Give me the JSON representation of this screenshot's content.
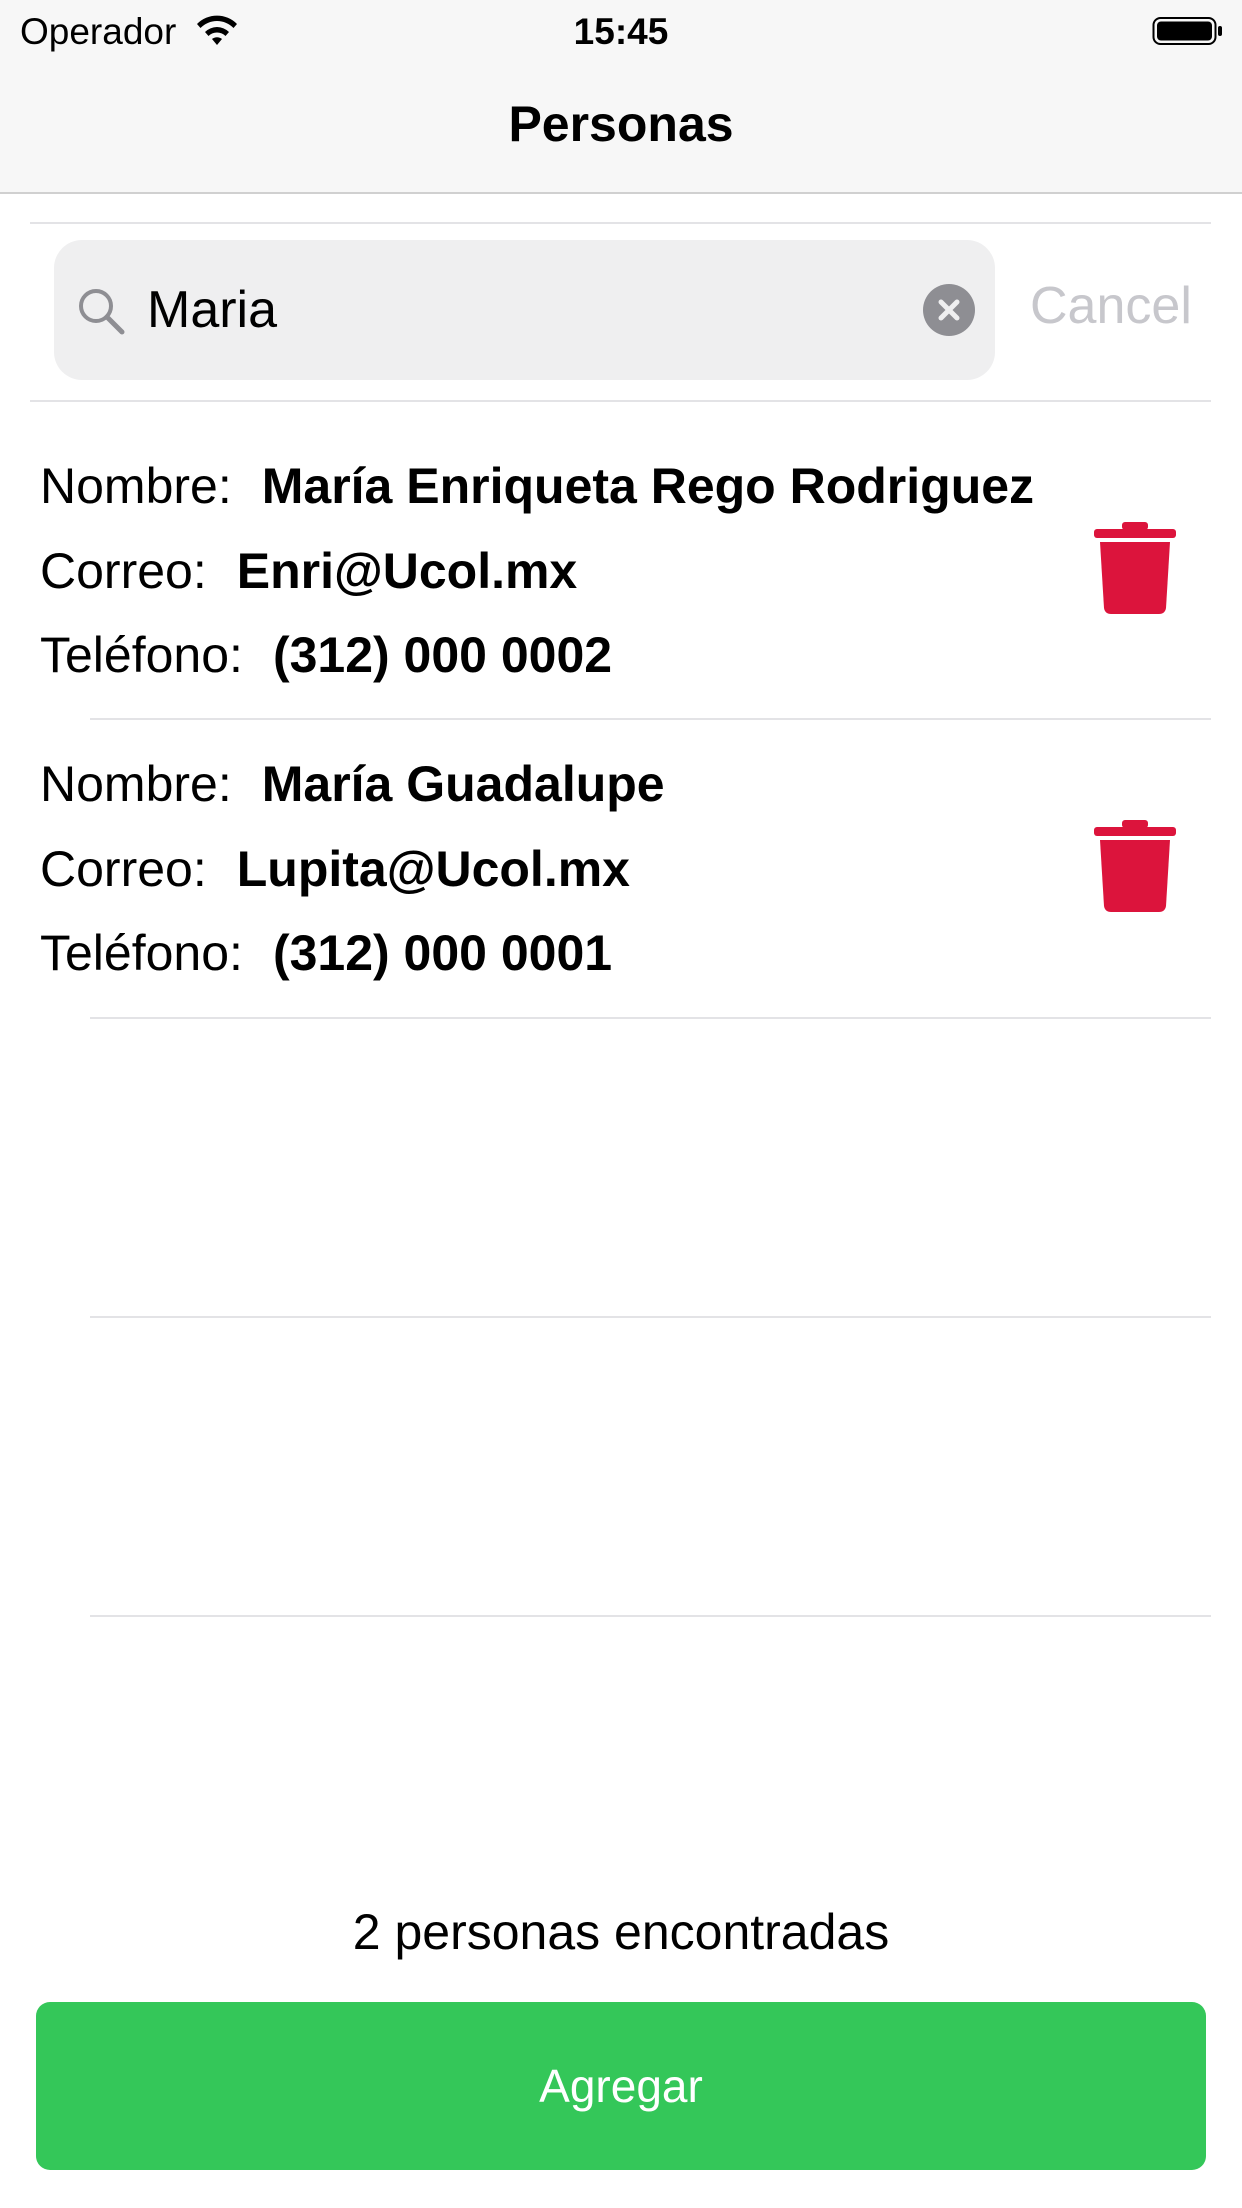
{
  "status_bar": {
    "carrier": "Operador",
    "time": "15:45"
  },
  "nav": {
    "title": "Personas"
  },
  "search": {
    "value": "Maria",
    "cancel_label": "Cancel"
  },
  "people": [
    {
      "name_label": "Nombre:",
      "name": "María Enriqueta Rego Rodriguez",
      "email_label": "Correo:",
      "email": "Enri@Ucol.mx",
      "phone_label": "Teléfono:",
      "phone": "(312) 000 0002"
    },
    {
      "name_label": "Nombre:",
      "name": "María Guadalupe",
      "email_label": "Correo:",
      "email": "Lupita@Ucol.mx",
      "phone_label": "Teléfono:",
      "phone": "(312) 000 0001"
    }
  ],
  "footer": {
    "count_text": "2 personas encontradas",
    "add_label": "Agregar"
  },
  "colors": {
    "accent_green": "#34c759",
    "delete_red": "#dc143c",
    "cancel_gray": "#c7c7cc"
  }
}
